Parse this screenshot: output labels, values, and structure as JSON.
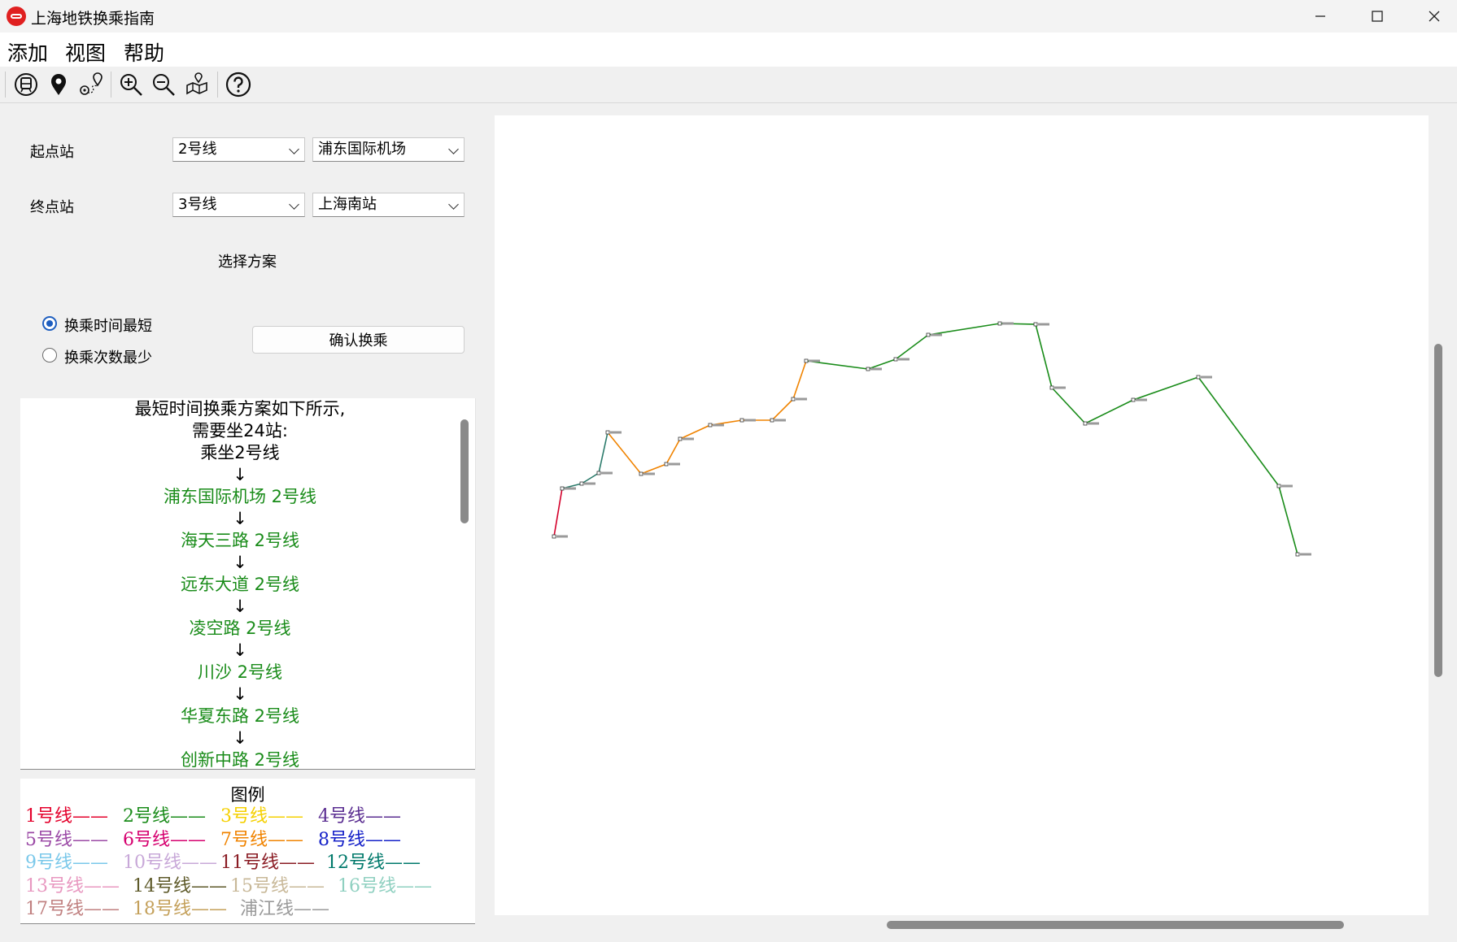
{
  "window": {
    "title": "上海地铁换乘指南",
    "minimize_icon": "minimize-icon",
    "maximize_icon": "maximize-icon",
    "close_icon": "close-icon"
  },
  "menu": [
    "添加",
    "视图",
    "帮助"
  ],
  "toolbar_icons": [
    "metro-train-icon",
    "location-pin-icon",
    "route-pins-icon",
    "zoom-in-icon",
    "zoom-out-icon",
    "map-icon",
    "help-icon"
  ],
  "form": {
    "start_label": "起点站",
    "start_line": "2号线",
    "start_station": "浦东国际机场",
    "end_label": "终点站",
    "end_line": "3号线",
    "end_station": "上海南站",
    "scheme_label": "选择方案",
    "option_shortest_time": "换乘时间最短",
    "option_fewest_transfers": "换乘次数最少",
    "selected_option": "换乘时间最短",
    "confirm_button": "确认换乘"
  },
  "result": {
    "header": [
      "最短时间换乘方案如下所示,",
      "需要坐24站:",
      "乘坐2号线"
    ],
    "arrow": "↓",
    "stations": [
      "浦东国际机场 2号线",
      "海天三路 2号线",
      "远东大道 2号线",
      "凌空路 2号线",
      "川沙 2号线",
      "华夏东路 2号线",
      "创新中路 2号线"
    ],
    "station_color": "#1a8c1a"
  },
  "legend": {
    "title": "图例",
    "rows": [
      [
        {
          "text": "1号线——",
          "color": "#e4002b"
        },
        {
          "text": "2号线——",
          "color": "#1a8c1a"
        },
        {
          "text": "3号线——",
          "color": "#f5d000"
        },
        {
          "text": "4号线——",
          "color": "#5a2d91"
        }
      ],
      [
        {
          "text": "5号线——",
          "color": "#9b4aa6"
        },
        {
          "text": "6号线——",
          "color": "#d6006f"
        },
        {
          "text": "7号线——",
          "color": "#f08300"
        },
        {
          "text": "8号线——",
          "color": "#1420c8"
        }
      ],
      [
        {
          "text": "9号线——",
          "color": "#7ac8ea"
        },
        {
          "text": "10号线——",
          "color": "#c8a8d8"
        },
        {
          "text": "11号线——",
          "color": "#8a1c24"
        },
        {
          "text": "12号线——",
          "color": "#00796b"
        }
      ],
      [
        {
          "text": "13号线——",
          "color": "#e898c0"
        },
        {
          "text": "14号线——",
          "color": "#5e5a2a"
        },
        {
          "text": "15号线——",
          "color": "#c8b898"
        },
        {
          "text": "16号线——",
          "color": "#8fd0c0"
        }
      ],
      [
        {
          "text": "17号线——",
          "color": "#c08080"
        },
        {
          "text": "18号线——",
          "color": "#c4a05a"
        },
        {
          "text": "浦江线——",
          "color": "#9a9a9a"
        }
      ]
    ]
  },
  "map": {
    "colors": {
      "line1": "#d4002b",
      "line2": "#1a8c1a",
      "line12": "#2a7a6a",
      "line7": "#f08300"
    }
  }
}
